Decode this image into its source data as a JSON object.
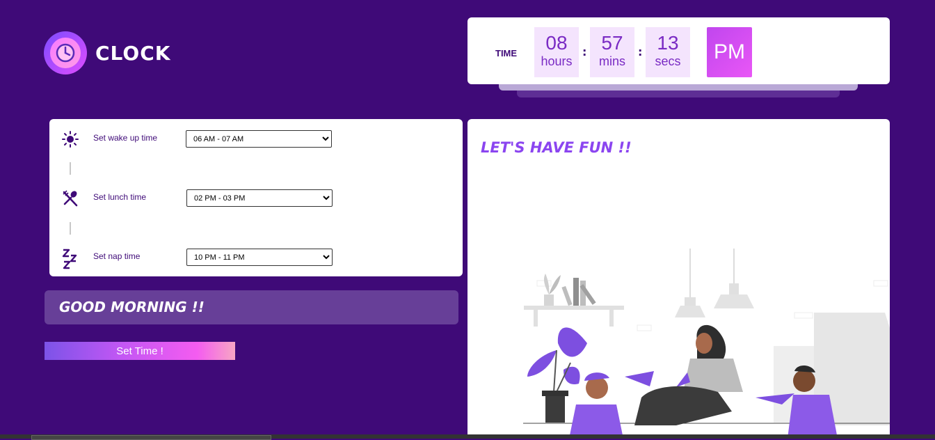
{
  "logo": {
    "text": "CLOCK",
    "icon": "clock-icon"
  },
  "clock": {
    "label": "TIME",
    "hours": "08",
    "hours_unit": "hours",
    "mins": "57",
    "mins_unit": "mins",
    "secs": "13",
    "secs_unit": "secs",
    "separator": ":",
    "period": "PM"
  },
  "schedule": {
    "wake": {
      "label": "Set wake up time",
      "value": "06 AM - 07 AM",
      "icon": "sun-icon"
    },
    "lunch": {
      "label": "Set lunch time",
      "value": "02 PM - 03 PM",
      "icon": "utensils-icon"
    },
    "nap": {
      "label": "Set nap time",
      "value": "10 PM - 11 PM",
      "icon": "zzz-icon"
    }
  },
  "greeting": "GOOD MORNING !!",
  "set_button": "Set Time !",
  "fun_title": "LET'S HAVE FUN !!",
  "colors": {
    "background": "#3f0a78",
    "accent": "#8b45f0",
    "period_bg": "#d24ef2"
  }
}
